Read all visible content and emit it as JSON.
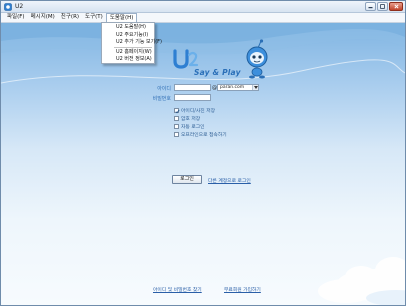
{
  "window": {
    "title": "U2"
  },
  "menu": {
    "items": [
      {
        "label": "파일(F)"
      },
      {
        "label": "메시지(M)"
      },
      {
        "label": "친구(R)"
      },
      {
        "label": "도구(T)"
      },
      {
        "label": "도움말(H)"
      }
    ]
  },
  "help_menu": {
    "items": [
      {
        "label": "U2 도움말(H)"
      },
      {
        "label": "U2 주요기능(I)"
      },
      {
        "label": "U2 추가 기능 보기(F)"
      },
      {
        "label": "U2 홈페이지(W)"
      },
      {
        "label": "U2 버전 정보(A)"
      }
    ]
  },
  "brand": {
    "slogan": "Say & Play"
  },
  "login_form": {
    "id_label": "아이디",
    "at_sign": "@",
    "domain_value": "paran.com",
    "password_label": "비밀번호",
    "options": [
      {
        "label": "아이디/사진 저장",
        "checked": true
      },
      {
        "label": "암호 저장",
        "checked": false
      },
      {
        "label": "자동 로그인",
        "checked": false
      },
      {
        "label": "오프라인으로 접속하기",
        "checked": false
      }
    ],
    "login_button": "로그인",
    "other_account_link": "다른 계정으로 로그인"
  },
  "footer": {
    "find_link": "아이디 및 비밀번호 찾기",
    "signup_link": "무료회원 가입하기"
  },
  "colors": {
    "accent": "#2a6fb8",
    "link": "#2a5fa8"
  }
}
